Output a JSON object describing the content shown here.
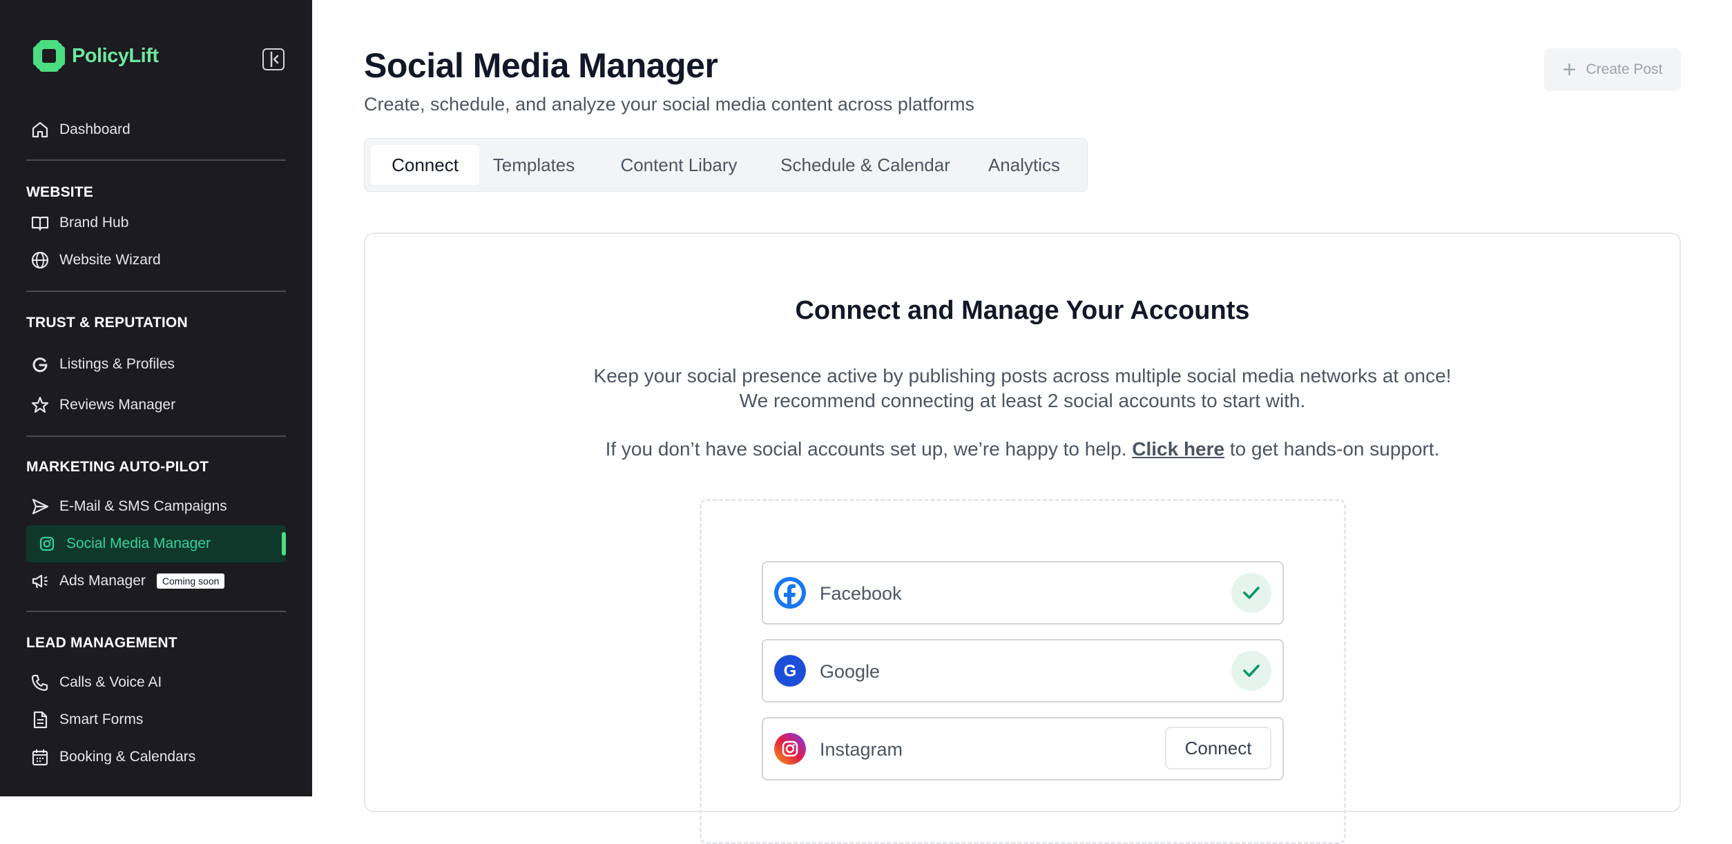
{
  "brand": {
    "name": "PolicyLift",
    "accent": "#6ee7a0"
  },
  "sidebar": {
    "dashboard": "Dashboard",
    "sections": {
      "website": {
        "title": "WEBSITE",
        "items": [
          {
            "label": "Brand Hub",
            "icon": "book-icon"
          },
          {
            "label": "Website Wizard",
            "icon": "globe-icon"
          }
        ]
      },
      "trust": {
        "title": "TRUST & REPUTATION",
        "items": [
          {
            "label": "Listings & Profiles",
            "icon": "google-icon"
          },
          {
            "label": "Reviews Manager",
            "icon": "star-icon"
          }
        ]
      },
      "marketing": {
        "title": "MARKETING AUTO-PILOT",
        "items": [
          {
            "label": "E-Mail & SMS Campaigns",
            "icon": "send-icon"
          },
          {
            "label": "Social Media Manager",
            "icon": "instagram-icon",
            "active": true
          },
          {
            "label": "Ads Manager",
            "icon": "megaphone-icon",
            "badge": "Coming soon"
          }
        ]
      },
      "lead": {
        "title": "LEAD MANAGEMENT",
        "items": [
          {
            "label": "Calls & Voice AI",
            "icon": "phone-icon"
          },
          {
            "label": "Smart Forms",
            "icon": "document-icon"
          },
          {
            "label": "Booking & Calendars",
            "icon": "calendar-icon"
          }
        ]
      }
    }
  },
  "header": {
    "title": "Social Media Manager",
    "subtitle": "Create, schedule, and analyze your social media content across platforms",
    "create_button": "Create Post"
  },
  "tabs": [
    "Connect",
    "Templates",
    "Content Libary",
    "Schedule & Calendar",
    "Analytics"
  ],
  "active_tab": "Connect",
  "card": {
    "title": "Connect and Manage Your Accounts",
    "desc_line1": "Keep your social presence active by publishing posts across multiple social media networks at once!",
    "desc_line2": "We recommend connecting at least 2 social accounts to start with.",
    "help_prefix": "If you don’t have social accounts set up, we’re happy to help.",
    "help_link": "Click here",
    "help_suffix": "to get hands-on support."
  },
  "accounts": [
    {
      "name": "Facebook",
      "status": "connected",
      "icon": "facebook-icon"
    },
    {
      "name": "Google",
      "status": "connected",
      "icon": "google-icon"
    },
    {
      "name": "Instagram",
      "status": "not-connected",
      "action": "Connect",
      "icon": "instagram-icon"
    }
  ],
  "colors": {
    "sidebar_bg": "#1c1b1f",
    "active_bg": "#10382a",
    "active_text": "#34d399",
    "check": "#059669"
  }
}
